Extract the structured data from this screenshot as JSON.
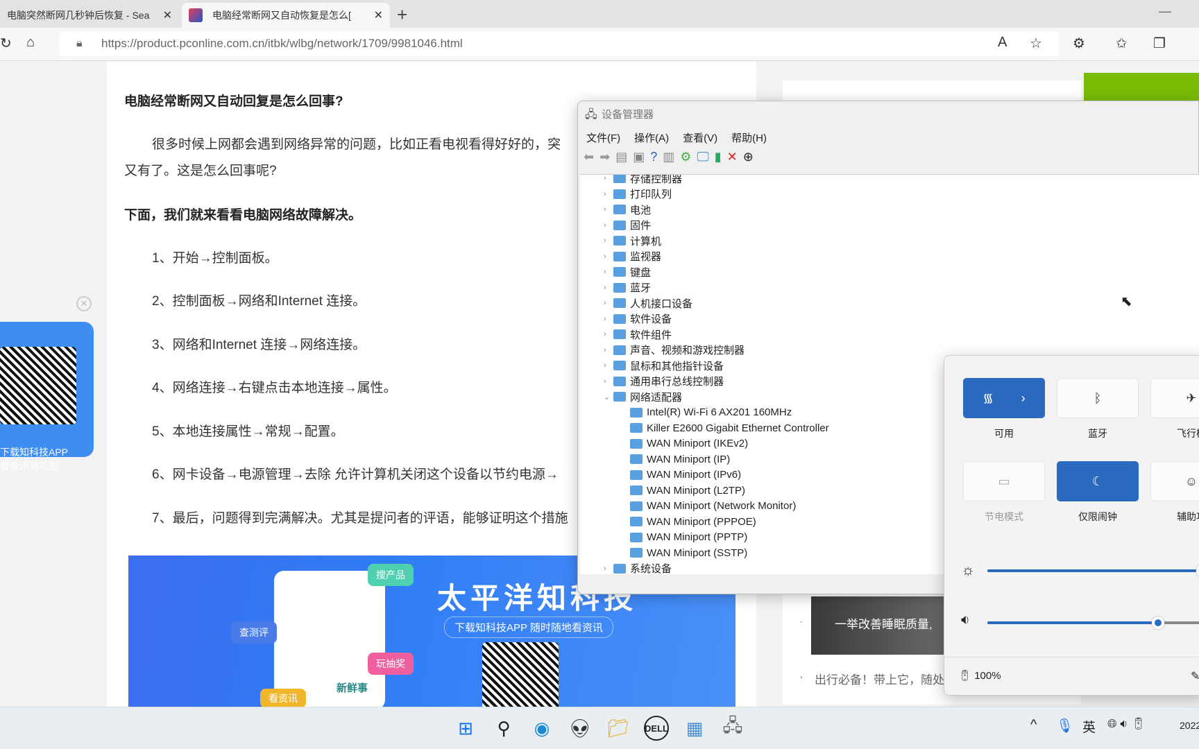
{
  "browser": {
    "tabs": [
      {
        "label": "电脑突然断网几秒钟后恢复 - Sea"
      },
      {
        "label": "电脑经常断网又自动恢复是怎么[",
        "active": true
      }
    ],
    "url": "https://product.pconline.com.cn/itbk/wlbg/network/1709/9981046.html"
  },
  "article": {
    "title": "电脑经常断网又自动回复是怎么回事?",
    "para1a": "很多时候上网都会遇到网络异常的问题，比如正看电视看得好好的，突",
    "para1b": "又有了。这是怎么回事呢?",
    "subtitle": "下面，我们就来看看电脑网络故障解决。",
    "steps": [
      "1、开始→控制面板。",
      "2、控制面板→网络和Internet 连接。",
      "3、网络和Internet 连接→网络连接。",
      "4、网络连接→右键点击本地连接→属性。",
      "5、本地连接属性→常规→配置。",
      "6、网卡设备→电源管理→去除 允许计算机关闭这个设备以节约电源→",
      "7、最后，问题得到完满解决。尤其是提问者的评语，能够证明这个措施"
    ]
  },
  "banner": {
    "brand": "太平洋知科技",
    "slogan": "下载知科技APP 随时随地看资讯",
    "tags": [
      "搜产品",
      "查测评",
      "玩抽奖",
      "看资讯",
      "新鲜事"
    ]
  },
  "float_ad": {
    "line1": "下载知科技APP",
    "line2": "看资讯领礼包"
  },
  "sidebar": {
    "item1": "一举改善睡眠质量,",
    "item2": "出行必备！带上它，随处"
  },
  "device_manager": {
    "title": "设备管理器",
    "menu": [
      "文件(F)",
      "操作(A)",
      "查看(V)",
      "帮助(H)"
    ],
    "categories": [
      "存储控制器",
      "打印队列",
      "电池",
      "固件",
      "计算机",
      "监视器",
      "键盘",
      "蓝牙",
      "人机接口设备",
      "软件设备",
      "软件组件",
      "声音、视频和游戏控制器",
      "鼠标和其他指针设备",
      "通用串行总线控制器",
      "网络适配器"
    ],
    "network_adapters": [
      "Intel(R) Wi-Fi 6 AX201 160MHz",
      "Killer E2600 Gigabit Ethernet Controller",
      "WAN Miniport (IKEv2)",
      "WAN Miniport (IP)",
      "WAN Miniport (IPv6)",
      "WAN Miniport (L2TP)",
      "WAN Miniport (Network Monitor)",
      "WAN Miniport (PPPOE)",
      "WAN Miniport (PPTP)",
      "WAN Miniport (SSTP)"
    ],
    "last_category": "系统设备"
  },
  "quick_settings": {
    "tiles": [
      {
        "label": "可用",
        "icon": "wifi-icon",
        "on": true
      },
      {
        "label": "蓝牙",
        "icon": "bluetooth-icon",
        "on": false
      },
      {
        "label": "飞行模",
        "icon": "airplane-icon",
        "on": false
      },
      {
        "label": "节电模式",
        "icon": "battery-saver-icon",
        "on": false
      },
      {
        "label": "仅限闹钟",
        "icon": "moon-icon",
        "on": true
      },
      {
        "label": "辅助功",
        "icon": "accessibility-icon",
        "on": false
      }
    ],
    "brightness_pct": 97,
    "volume_pct": 77,
    "battery": "100%",
    "accent": "#2a6bbf"
  },
  "taskbar": {
    "ime": "英",
    "clock": "2022"
  }
}
